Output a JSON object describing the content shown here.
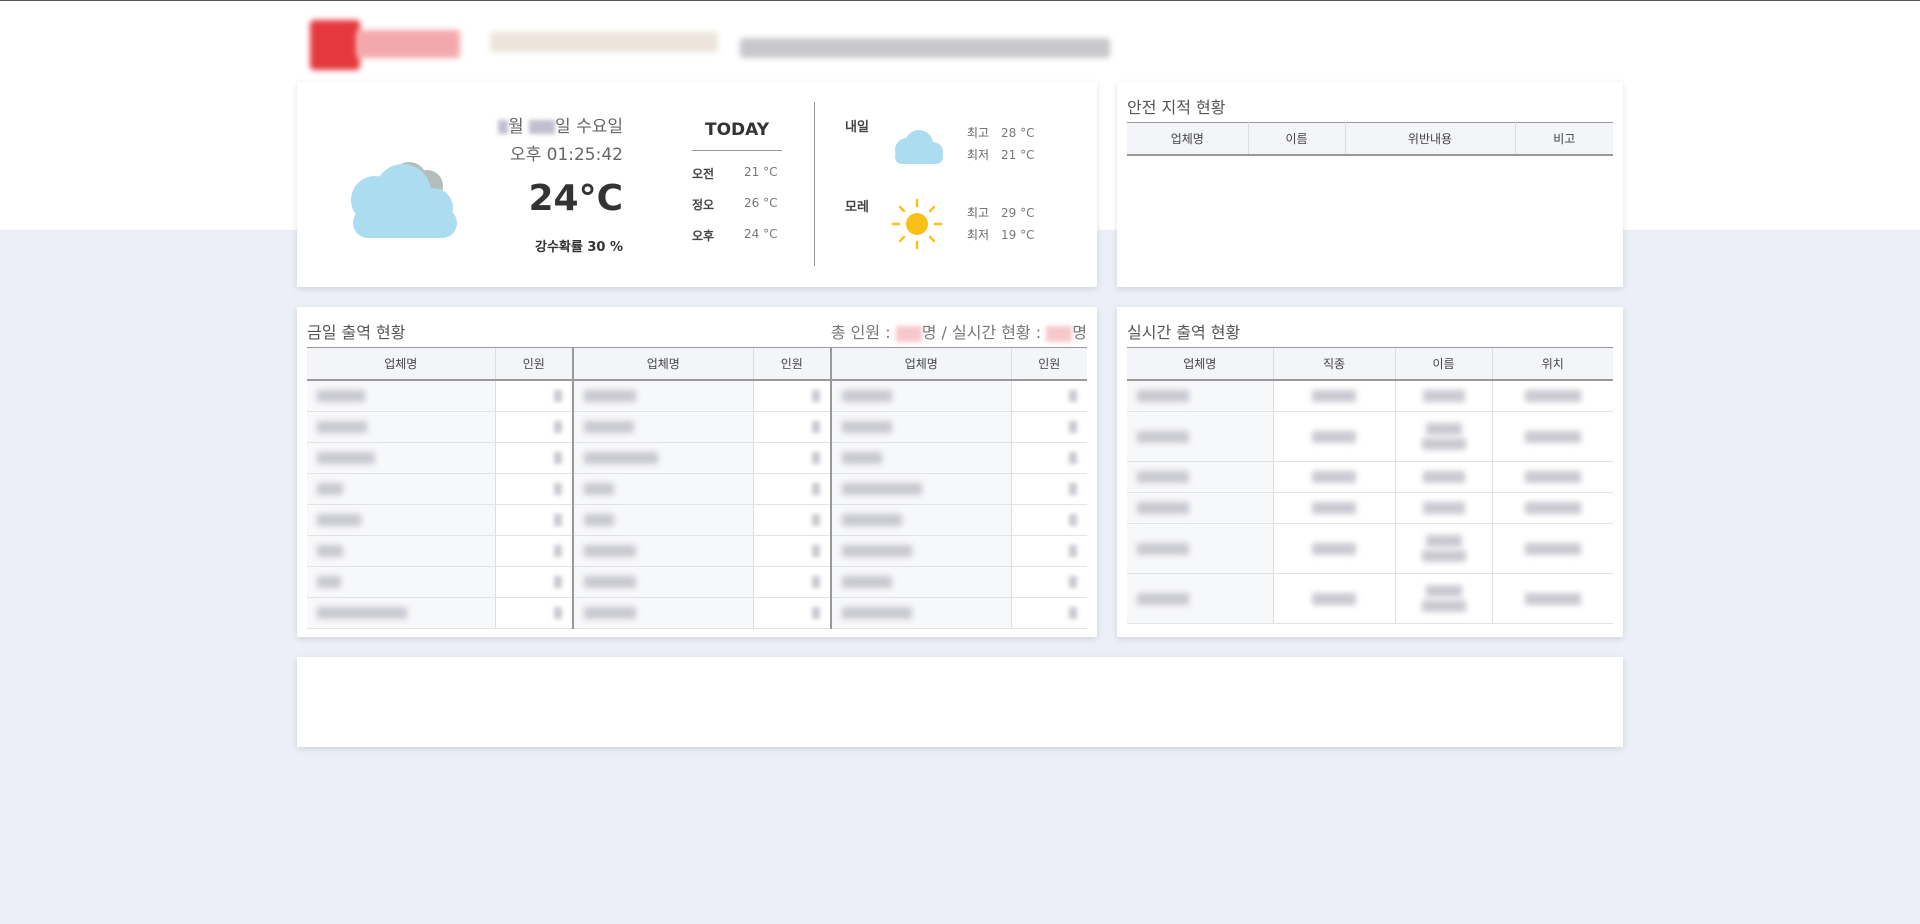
{
  "weather": {
    "date_month_suffix": "월",
    "date_day_suffix": "일 수요일",
    "time": "오후 01:25:42",
    "temp_now": "24°C",
    "rain_prob": "강수확률 30 %",
    "today": {
      "title": "TODAY",
      "rows": [
        {
          "label": "오전",
          "value": "21 °C"
        },
        {
          "label": "정오",
          "value": "26 °C"
        },
        {
          "label": "오후",
          "value": "24 °C"
        }
      ]
    },
    "forecast": [
      {
        "day": "내일",
        "icon": "cloud-icon",
        "max_label": "최고",
        "max": "28 °C",
        "min_label": "최저",
        "min": "21 °C"
      },
      {
        "day": "모레",
        "icon": "sun-icon",
        "max_label": "최고",
        "max": "29 °C",
        "min_label": "최저",
        "min": "19 °C"
      }
    ],
    "colors": {
      "cloud": "#acdcf0",
      "cloud_back": "#b4bcbc",
      "sun": "#fbbf1a"
    }
  },
  "safety": {
    "title": "안전 지적 현황",
    "columns": [
      "업체명",
      "이름",
      "위반내용",
      "비고"
    ]
  },
  "daily": {
    "title": "금일 출역 현황",
    "total_prefix": "총 인원 :",
    "total_unit": "명",
    "sep": "/",
    "realtime_prefix": "실시간 현황 :",
    "realtime_unit": "명",
    "columns": [
      "업체명",
      "인원",
      "업체명",
      "인원",
      "업체명",
      "인원"
    ]
  },
  "realtime": {
    "title": "실시간 출역 현황",
    "columns": [
      "업체명",
      "직종",
      "이름",
      "위치"
    ]
  },
  "colors": {
    "background": "#eceff7",
    "card": "#ffffff",
    "brand": "#e5383e"
  }
}
